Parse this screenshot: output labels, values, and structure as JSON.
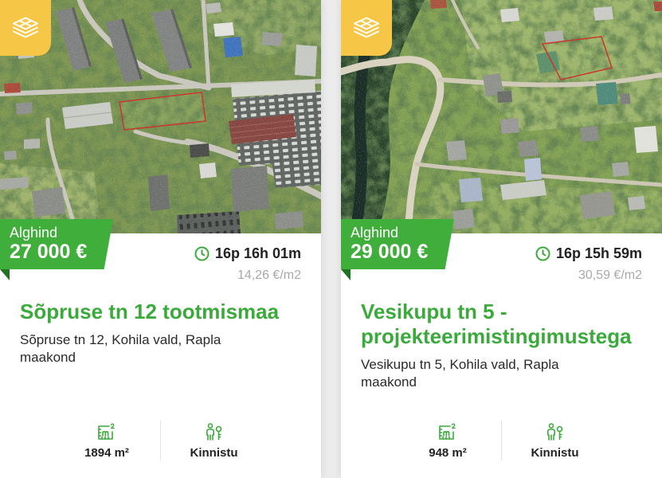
{
  "colors": {
    "accent_green": "#3aaa3a",
    "tag_green": "#3fae3a",
    "tag_fold_green": "#1f7323",
    "badge_yellow": "#f6c646",
    "muted_text": "#a9a9a9"
  },
  "icons": {
    "badge": "layers-icon",
    "timer": "clock-icon",
    "area": "area-m2-icon",
    "property_type": "person-key-icon"
  },
  "listings": [
    {
      "price_label": "Alghind",
      "price": "27 000 €",
      "time_left": "16p 16h 01m",
      "price_per_m2": "14,26 €/m2",
      "title": "Sõpruse tn 12 tootmismaa",
      "address": "Sõpruse tn 12, Kohila vald, Rapla maakond",
      "area": "1894 m²",
      "property_type": "Kinnistu"
    },
    {
      "price_label": "Alghind",
      "price": "29 000 €",
      "time_left": "16p 15h 59m",
      "price_per_m2": "30,59 €/m2",
      "title": "Vesikupu tn 5 - projekteerimistingimustega",
      "address": "Vesikupu tn 5, Kohila vald, Rapla maakond",
      "area": "948 m²",
      "property_type": "Kinnistu"
    }
  ]
}
